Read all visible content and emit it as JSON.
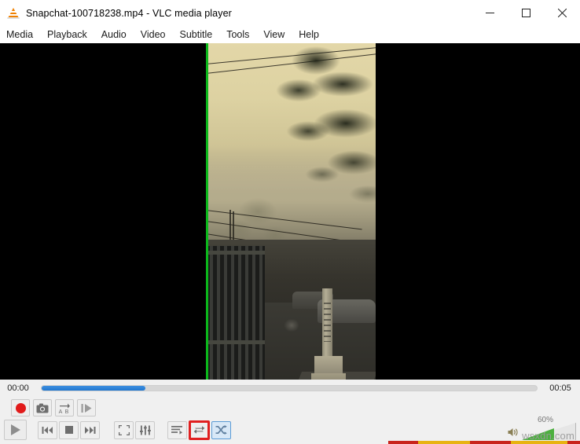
{
  "window": {
    "title": "Snapchat-100718238.mp4 - VLC media player",
    "app_icon": "vlc-cone-icon",
    "controls": {
      "minimize": "minimize-icon",
      "maximize": "maximize-icon",
      "close": "close-icon"
    }
  },
  "menubar": {
    "items": [
      {
        "label": "Media"
      },
      {
        "label": "Playback"
      },
      {
        "label": "Audio"
      },
      {
        "label": "Video"
      },
      {
        "label": "Subtitle"
      },
      {
        "label": "Tools"
      },
      {
        "label": "View"
      },
      {
        "label": "Help"
      }
    ]
  },
  "video": {
    "description": "Hazy sepia outdoor scene: large conifer tree, overhead power lines, iron gate, concrete post and parked cars on a foggy street",
    "aspect": "portrait",
    "left_edge_marker_color": "#0bb81b",
    "background_color": "#000000"
  },
  "seekbar": {
    "elapsed": "00:00",
    "remaining": "00:05",
    "progress_percent": 21,
    "fill_color": "#2277cf",
    "track_color": "#d6d6d6"
  },
  "advanced_controls": {
    "buttons": [
      {
        "name": "record-button",
        "icon": "record-icon",
        "label": "Record"
      },
      {
        "name": "snapshot-button",
        "icon": "camera-icon",
        "label": "Take Snapshot"
      },
      {
        "name": "ab-loop-button",
        "icon": "ab-loop-icon",
        "label": "Loop from point A to point B continuously"
      },
      {
        "name": "frame-by-frame-button",
        "icon": "frame-step-icon",
        "label": "Frame by frame"
      }
    ]
  },
  "playback_controls": {
    "play": {
      "name": "play-button",
      "icon": "play-icon",
      "label": "Play"
    },
    "previous": {
      "name": "previous-button",
      "icon": "skip-back-icon",
      "label": "Previous media in the playlist"
    },
    "stop": {
      "name": "stop-button",
      "icon": "stop-icon",
      "label": "Stop playback"
    },
    "next": {
      "name": "next-button",
      "icon": "skip-forward-icon",
      "label": "Next media in the playlist"
    },
    "fullscreen": {
      "name": "fullscreen-button",
      "icon": "fullscreen-icon",
      "label": "Toggle the video in fullscreen"
    },
    "extended_settings": {
      "name": "extended-settings-button",
      "icon": "equalizer-icon",
      "label": "Show extended settings"
    },
    "playlist": {
      "name": "playlist-button",
      "icon": "playlist-icon",
      "label": "Show playlist"
    },
    "loop": {
      "name": "loop-button",
      "icon": "loop-icon",
      "label": "Click to toggle between loop all, loop one and no loop",
      "highlight": true,
      "highlight_color": "#e02020"
    },
    "shuffle": {
      "name": "shuffle-button",
      "icon": "shuffle-icon",
      "label": "Random",
      "active": true,
      "active_color": "#5b9bd5"
    }
  },
  "volume": {
    "icon": "speaker-icon",
    "level_label": "60%",
    "level_percent": 60,
    "fill_color": "#4caf3f"
  },
  "watermark": {
    "text": "wsxdn.com"
  }
}
